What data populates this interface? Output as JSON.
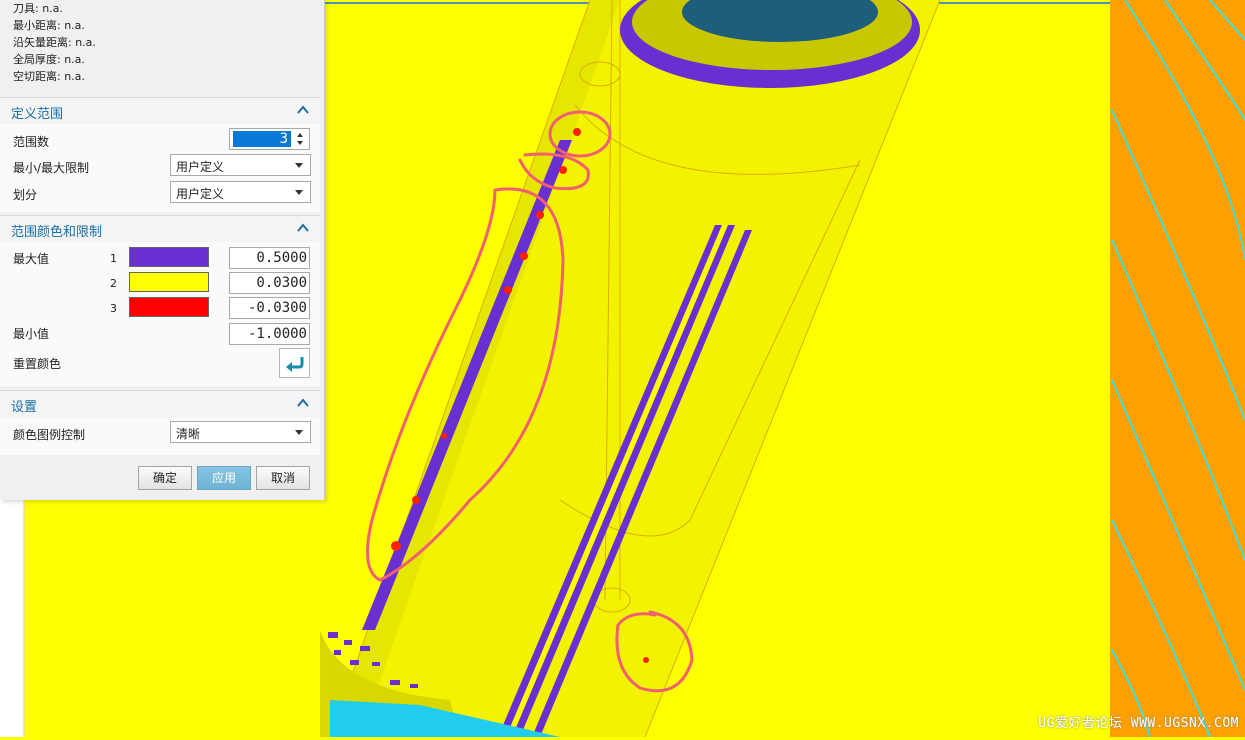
{
  "info": {
    "tool": "刀具: n.a.",
    "min_distance": "最小距离: n.a.",
    "vector_distance": "沿矢量距离: n.a.",
    "global_thickness": "全局厚度: n.a.",
    "air_cut_distance": "空切距离: n.a."
  },
  "define_range": {
    "title": "定义范围",
    "range_count_label": "范围数",
    "range_count_value": "3",
    "minmax_label": "最小/最大限制",
    "minmax_value": "用户定义",
    "division_label": "划分",
    "division_value": "用户定义"
  },
  "range_colors": {
    "title": "范围颜色和限制",
    "max_label": "最大值",
    "min_label": "最小值",
    "reset_label": "重置颜色",
    "rows": [
      {
        "index": "1",
        "color": "#6a2fd0",
        "value": "0.5000"
      },
      {
        "index": "2",
        "color": "#ffff00",
        "value": "0.0300"
      },
      {
        "index": "3",
        "color": "#ff0000",
        "value": "-0.0300"
      }
    ],
    "min_value": "-1.0000"
  },
  "settings": {
    "title": "设置",
    "legend_label": "颜色图例控制",
    "legend_value": "清晰"
  },
  "buttons": {
    "ok": "确定",
    "apply": "应用",
    "cancel": "取消"
  },
  "colors": {
    "part_yellow": "#ffff00",
    "stock_purple": "#6a2fd0",
    "gouge_red": "#ff0000",
    "side_orange": "#ffa000",
    "annotation_pink": "#f06070",
    "section_title": "#1a6ea8"
  },
  "watermark": "UG爱好者论坛 WWW.UGSNX.COM"
}
